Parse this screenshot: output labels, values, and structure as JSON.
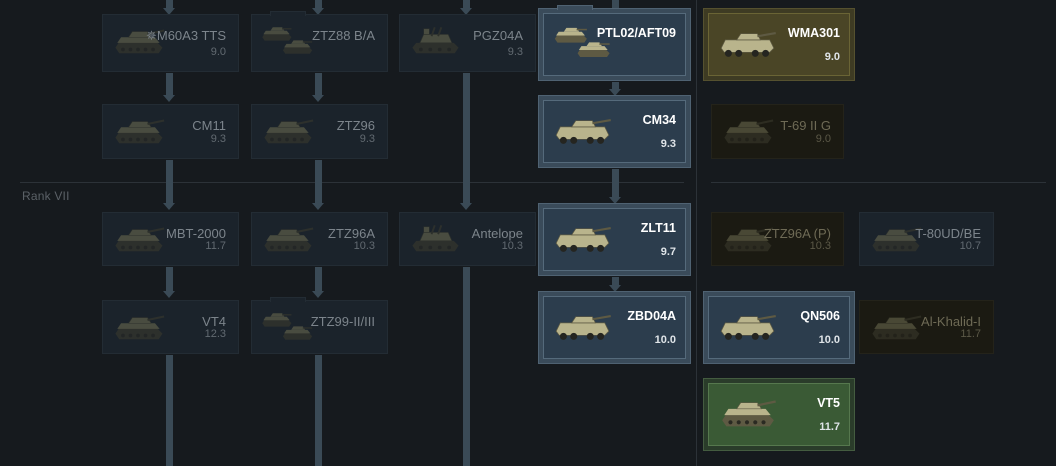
{
  "rank_label": "Rank VII",
  "vehicles": [
    {
      "name": "✵M60A3 TTS",
      "br": "9.0",
      "state": "locked",
      "kind": "tank",
      "icon": "tank-icon"
    },
    {
      "name": "ZTZ88 B/A",
      "br": "",
      "state": "locked",
      "kind": "group",
      "icon": "tank-group-icon"
    },
    {
      "name": "PGZ04A",
      "br": "9.3",
      "state": "locked",
      "kind": "aa",
      "icon": "spaa-icon"
    },
    {
      "name": "PTL02/AFT09",
      "br": "",
      "state": "researched",
      "kind": "group",
      "icon": "wheeled-group-icon"
    },
    {
      "name": "WMA301",
      "br": "9.0",
      "state": "premium",
      "kind": "wheeled",
      "icon": "wheeled-tank-icon"
    },
    {
      "name": "CM11",
      "br": "9.3",
      "state": "locked",
      "kind": "tank",
      "icon": "tank-icon"
    },
    {
      "name": "ZTZ96",
      "br": "9.3",
      "state": "locked",
      "kind": "tank",
      "icon": "tank-icon"
    },
    {
      "name": "CM34",
      "br": "9.3",
      "state": "researched",
      "kind": "wheeled",
      "icon": "wheeled-ifv-icon"
    },
    {
      "name": "T-69 II G",
      "br": "9.0",
      "state": "premium-dim",
      "kind": "tank",
      "icon": "tank-icon"
    },
    {
      "name": "MBT-2000",
      "br": "11.7",
      "state": "locked",
      "kind": "tank",
      "icon": "tank-icon"
    },
    {
      "name": "ZTZ96A",
      "br": "10.3",
      "state": "locked",
      "kind": "tank",
      "icon": "tank-icon"
    },
    {
      "name": "Antelope",
      "br": "10.3",
      "state": "locked",
      "kind": "aa",
      "icon": "spaa-icon"
    },
    {
      "name": "ZLT11",
      "br": "9.7",
      "state": "researched",
      "kind": "wheeled",
      "icon": "wheeled-tank-icon"
    },
    {
      "name": "ZTZ96A (P)",
      "br": "10.3",
      "state": "premium-dim",
      "kind": "tank",
      "icon": "tank-icon"
    },
    {
      "name": "T-80UD/BE",
      "br": "10.7",
      "state": "locked",
      "kind": "tank",
      "icon": "tank-icon"
    },
    {
      "name": "VT4",
      "br": "12.3",
      "state": "locked",
      "kind": "tank",
      "icon": "tank-icon"
    },
    {
      "name": "ZTZ99-II/III",
      "br": "",
      "state": "locked",
      "kind": "group",
      "icon": "tank-group-icon"
    },
    {
      "name": "ZBD04A",
      "br": "10.0",
      "state": "researched",
      "kind": "ifv",
      "icon": "ifv-icon"
    },
    {
      "name": "QN506",
      "br": "10.0",
      "state": "researched",
      "kind": "ifv",
      "icon": "ifv-icon"
    },
    {
      "name": "Al-Khalid-I",
      "br": "11.7",
      "state": "premium-dim",
      "kind": "tank",
      "icon": "tank-icon"
    },
    {
      "name": "VT5",
      "br": "11.7",
      "state": "squadron",
      "kind": "tank",
      "icon": "tank-icon"
    }
  ]
}
